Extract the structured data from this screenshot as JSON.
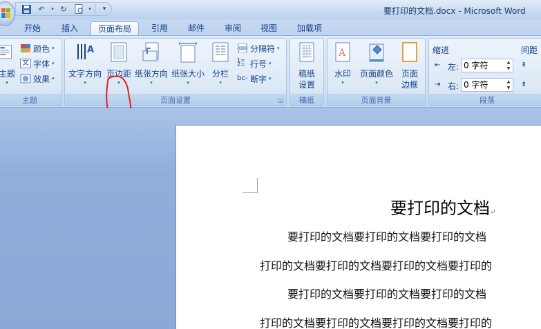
{
  "window": {
    "title": "要打印的文档.docx - Microsoft Word"
  },
  "quick_access": {
    "items": [
      "save-icon",
      "undo-icon",
      "redo-icon",
      "print-preview-icon",
      "customize-icon"
    ]
  },
  "tabs": [
    {
      "label": "开始",
      "active": false
    },
    {
      "label": "插入",
      "active": false
    },
    {
      "label": "页面布局",
      "active": true
    },
    {
      "label": "引用",
      "active": false
    },
    {
      "label": "邮件",
      "active": false
    },
    {
      "label": "审阅",
      "active": false
    },
    {
      "label": "视图",
      "active": false
    },
    {
      "label": "加载项",
      "active": false
    }
  ],
  "ribbon": {
    "theme": {
      "label": "主题",
      "big_label": "主题",
      "colors": "颜色",
      "fonts": "字体",
      "effects": "效果"
    },
    "page_setup": {
      "label": "页面设置",
      "text_direction": "文字方向",
      "margins": "页边距",
      "orientation": "纸张方向",
      "size": "纸张大小",
      "columns": "分栏",
      "breaks": "分隔符",
      "line_numbers": "行号",
      "hyphenation": "断字"
    },
    "manuscript": {
      "label": "稿纸",
      "settings": "稿纸\n设置"
    },
    "page_background": {
      "label": "页面背景",
      "watermark": "水印",
      "page_color": "页面颜色",
      "page_borders": "页面\n边框"
    },
    "paragraph": {
      "label": "段落",
      "indent": "缩进",
      "spacing": "间距",
      "left_label": "左:",
      "left_value": "0 字符",
      "right_label": "右:",
      "right_value": "0 字符"
    }
  },
  "document": {
    "title": "要打印的文档",
    "lines": [
      "要打印的文档要打印的文档要打印的文档",
      "打印的文档要打印的文档要打印的文档要打印的",
      "要打印的文档要打印的文档要打印的文档",
      "打印的文档要打印的文档要打印的文档要打印的"
    ]
  },
  "colors": {
    "annotation": "#e02020",
    "ribbon_text": "#15428b"
  }
}
